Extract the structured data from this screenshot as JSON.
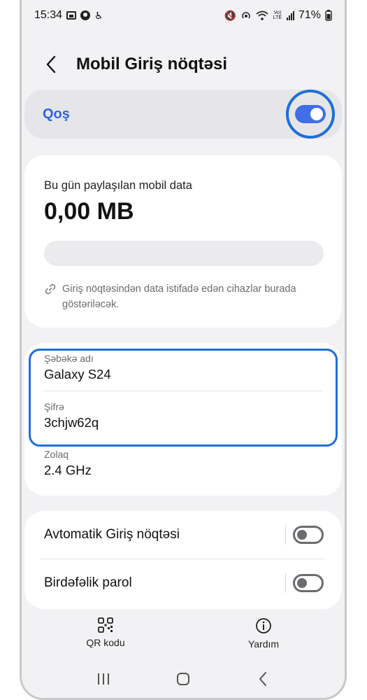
{
  "status_bar": {
    "time": "15:34",
    "vol_lte": "Vo) LTE",
    "battery": "71%"
  },
  "header": {
    "title": "Mobil Giriş nöqtəsi"
  },
  "master_switch": {
    "label": "Qoş",
    "state": "on"
  },
  "data_usage": {
    "caption": "Bu gün paylaşılan mobil data",
    "amount": "0,00 MB",
    "progress_fraction": 0,
    "note": "Giriş nöqtəsindən data istifadə edən cihazlar burada göstəriləcək."
  },
  "network": {
    "name_label": "Şəbəkə adı",
    "name_value": "Galaxy S24",
    "password_label": "Şifrə",
    "password_value": "3chjw62q",
    "band_label": "Zolaq",
    "band_value": "2.4 GHz"
  },
  "options": [
    {
      "label": "Avtomatik Giriş nöqtəsi",
      "state": "off"
    },
    {
      "label": "Birdəfəlik parol",
      "state": "off"
    }
  ],
  "actions": {
    "qr_label": "QR kodu",
    "help_label": "Yardım"
  },
  "colors": {
    "accent": "#3F6EE8",
    "highlight": "#1E6FD9",
    "master_label": "#3066D8"
  }
}
